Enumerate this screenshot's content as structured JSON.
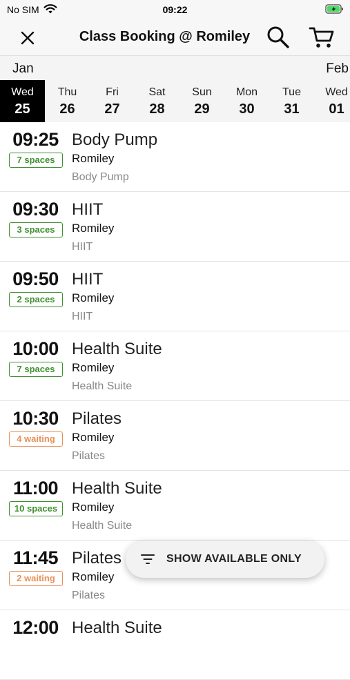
{
  "status_bar": {
    "carrier": "No SIM",
    "time": "09:22"
  },
  "header": {
    "title": "Class Booking @ Romiley"
  },
  "dates": {
    "month_left": "Jan",
    "month_right": "Feb",
    "days": [
      {
        "name": "Wed",
        "date": "25",
        "selected": true
      },
      {
        "name": "Thu",
        "date": "26"
      },
      {
        "name": "Fri",
        "date": "27"
      },
      {
        "name": "Sat",
        "date": "28"
      },
      {
        "name": "Sun",
        "date": "29"
      },
      {
        "name": "Mon",
        "date": "30"
      },
      {
        "name": "Tue",
        "date": "31"
      },
      {
        "name": "Wed",
        "date": "01"
      }
    ]
  },
  "classes": [
    {
      "time": "09:25",
      "badge": "7 spaces",
      "status": "available",
      "name": "Body Pump",
      "location": "Romiley",
      "category": "Body Pump"
    },
    {
      "time": "09:30",
      "badge": "3 spaces",
      "status": "available",
      "name": "HIIT",
      "location": "Romiley",
      "category": "HIIT"
    },
    {
      "time": "09:50",
      "badge": "2 spaces",
      "status": "available",
      "name": "HIIT",
      "location": "Romiley",
      "category": "HIIT"
    },
    {
      "time": "10:00",
      "badge": "7 spaces",
      "status": "available",
      "name": "Health Suite",
      "location": "Romiley",
      "category": "Health Suite"
    },
    {
      "time": "10:30",
      "badge": "4 waiting",
      "status": "waiting",
      "name": "Pilates",
      "location": "Romiley",
      "category": "Pilates"
    },
    {
      "time": "11:00",
      "badge": "10 spaces",
      "status": "available",
      "name": "Health Suite",
      "location": "Romiley",
      "category": "Health Suite"
    },
    {
      "time": "11:45",
      "badge": "2 waiting",
      "status": "waiting",
      "name": "Pilates",
      "location": "Romiley",
      "category": "Pilates"
    },
    {
      "time": "12:00",
      "badge": "",
      "status": "available",
      "name": "Health Suite",
      "location": "",
      "category": ""
    }
  ],
  "filter_button": {
    "label": "SHOW AVAILABLE ONLY"
  },
  "colors": {
    "available": "#3f8f2f",
    "waiting": "#e8905a",
    "selected_day_bg": "#000000"
  },
  "icons": {
    "close": "close-icon",
    "search": "search-icon",
    "cart": "cart-icon",
    "filter": "filter-icon",
    "wifi": "wifi-icon",
    "battery": "battery-charging-icon"
  }
}
